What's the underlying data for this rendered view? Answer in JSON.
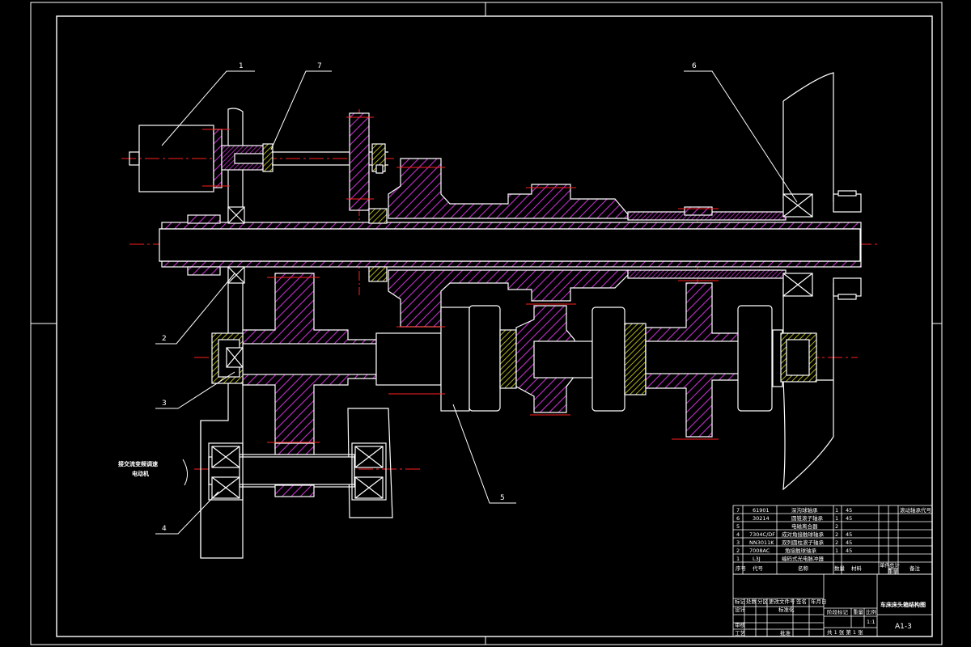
{
  "callouts": [
    {
      "id": "1",
      "label": "1"
    },
    {
      "id": "2",
      "label": "2"
    },
    {
      "id": "3",
      "label": "3"
    },
    {
      "id": "4",
      "label": "4"
    },
    {
      "id": "5",
      "label": "5"
    },
    {
      "id": "6",
      "label": "6"
    },
    {
      "id": "7",
      "label": "7"
    }
  ],
  "motor_note": {
    "line1": "接交流变频调速",
    "line2": "电动机"
  },
  "bom": {
    "rows": [
      {
        "no": "7",
        "code": "61901",
        "name": "深沟球轴承",
        "qty": "1",
        "material": "45",
        "note": "滚动轴承代号"
      },
      {
        "no": "6",
        "code": "30214",
        "name": "圆锥滚子轴承",
        "qty": "1",
        "material": "45",
        "note": ""
      },
      {
        "no": "5",
        "code": "",
        "name": "电磁离合器",
        "qty": "2",
        "material": "",
        "note": ""
      },
      {
        "no": "4",
        "code": "7304C/DF",
        "name": "成对角接触球轴承",
        "qty": "2",
        "material": "45",
        "note": ""
      },
      {
        "no": "3",
        "code": "NN3011K",
        "name": "双列圆柱滚子轴承",
        "qty": "2",
        "material": "45",
        "note": ""
      },
      {
        "no": "2",
        "code": "7008AC",
        "name": "角接触球轴承",
        "qty": "1",
        "material": "45",
        "note": ""
      },
      {
        "no": "1",
        "code": "L3J",
        "name": "编码式光电脉冲器",
        "qty": "",
        "material": "",
        "note": ""
      }
    ],
    "header": {
      "no": "序号",
      "code": "代号",
      "name": "名称",
      "qty": "数量",
      "material": "材料",
      "unit_weight": "单件",
      "total_weight": "总计",
      "weight": "重量",
      "note": "备注"
    }
  },
  "title_block": {
    "drawing_title": "车床床头箱结构图",
    "sheet_size": "A1-3",
    "scale_value": "1:1",
    "sheet_info": "共 1 张 第 1 张",
    "labels": {
      "mark": "标记",
      "count": "处数",
      "zone": "分区",
      "change_doc": "更改文件号",
      "signature": "签名",
      "date": "年月日",
      "design": "设计",
      "standardize": "标准化",
      "stage": "阶段标记",
      "weight": "重量",
      "scale": "比例",
      "review": "审核",
      "process": "工艺",
      "approve": "批准"
    }
  },
  "colors": {
    "background": "#000000",
    "outline": "#ffffff",
    "hatch": "#c030c8",
    "centerline": "#ff2020",
    "bearing_fill": "#d4d820"
  }
}
